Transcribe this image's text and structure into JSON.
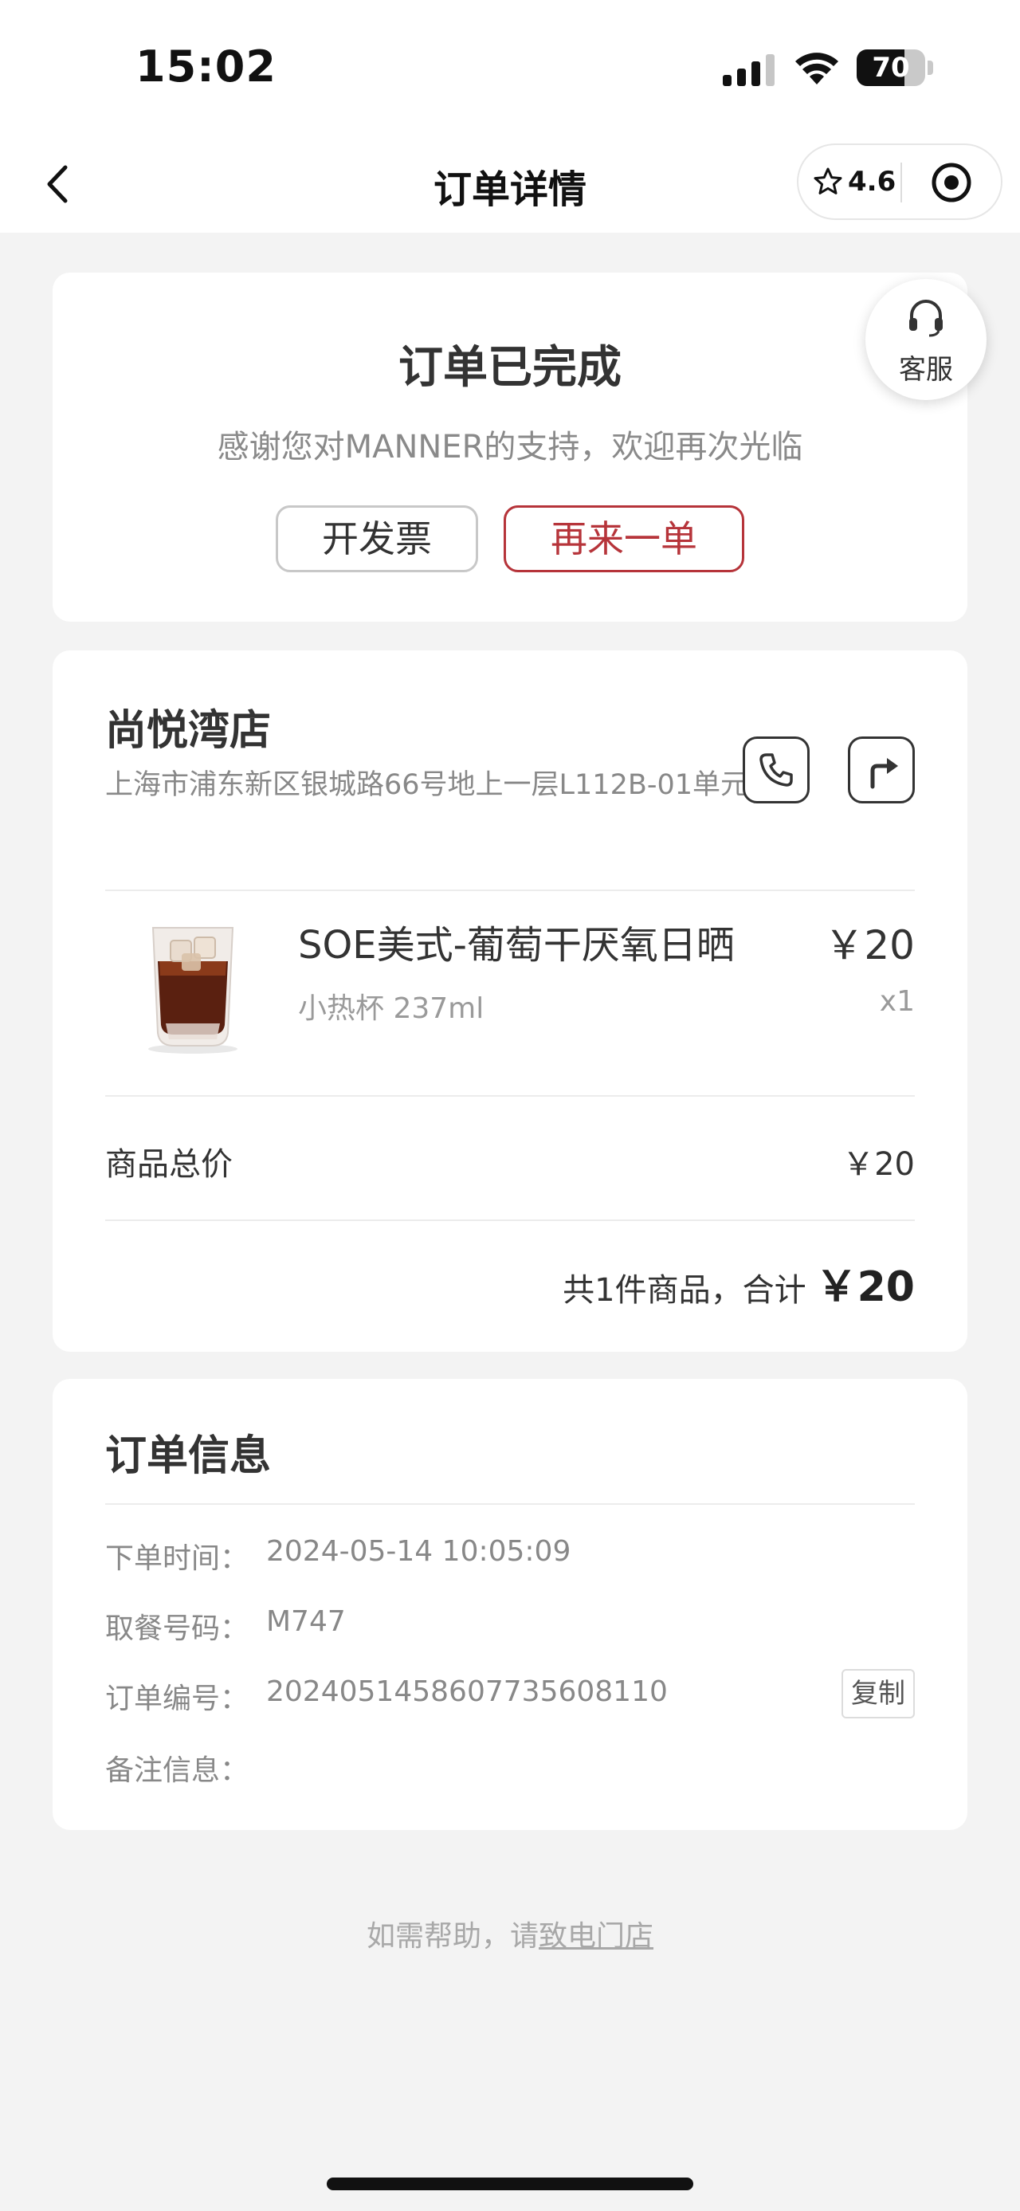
{
  "status_bar": {
    "time": "15:02",
    "battery_level": 70,
    "battery_label": "70",
    "signal_bars": 3,
    "icons": [
      "signal-icon",
      "wifi-icon",
      "battery-icon"
    ]
  },
  "nav": {
    "title": "订单详情",
    "rating": "4.6",
    "icons": [
      "back-chevron-icon",
      "star-icon",
      "target-icon"
    ]
  },
  "order_status": {
    "title": "订单已完成",
    "subtitle": "感谢您对MANNER的支持，欢迎再次光临",
    "invoice_button": "开发票",
    "reorder_button": "再来一单"
  },
  "customer_service": {
    "label": "客服"
  },
  "store": {
    "name": "尚悦湾店",
    "address": "上海市浦东新区银城路66号地上一层L112B-01单元"
  },
  "items": [
    {
      "name": "SOE美式-葡萄干厌氧日晒",
      "spec": "小热杯 237ml",
      "price": "￥20",
      "quantity": "x1"
    }
  ],
  "summary": {
    "subtotal_label": "商品总价",
    "subtotal_value": "￥20",
    "total_text": "共1件商品，合计",
    "total_value": "￥20"
  },
  "order_info": {
    "title": "订单信息",
    "order_time_label": "下单时间：",
    "order_time": "2024-05-14 10:05:09",
    "pickup_code_label": "取餐号码：",
    "pickup_code": "M747",
    "order_number_label": "订单编号：",
    "order_number": "2024051458607735608110",
    "copy_button": "复制",
    "remark_label": "备注信息："
  },
  "help": {
    "prefix": "如需帮助，请",
    "link": "致电门店"
  },
  "colors": {
    "accent": "#b6343a",
    "background": "#f3f3f3"
  }
}
